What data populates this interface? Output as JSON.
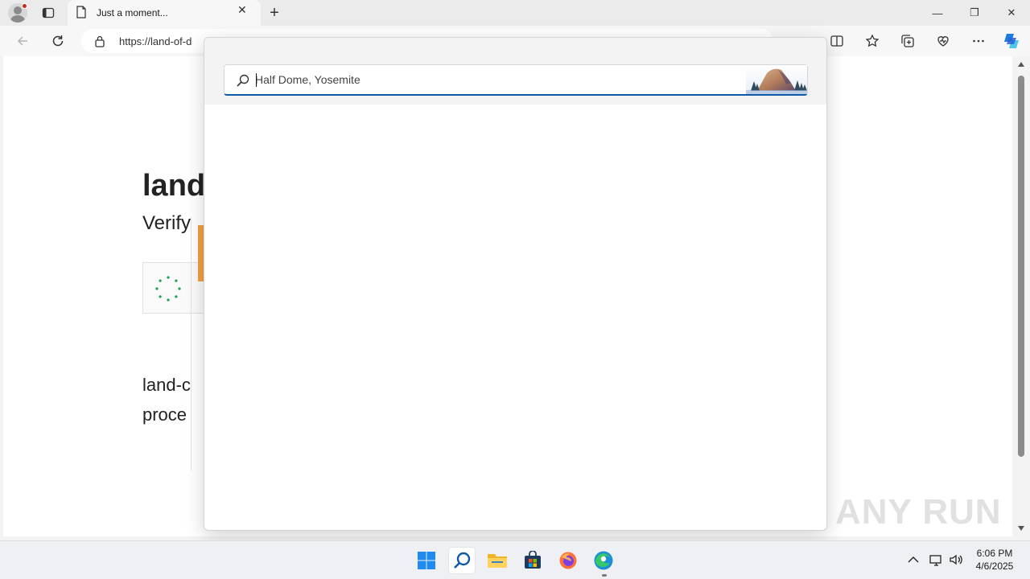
{
  "tab": {
    "title": "Just a moment...",
    "close_label": "✕"
  },
  "window_controls": {
    "minimize": "—",
    "restore": "❐",
    "close": "✕"
  },
  "address_bar": {
    "url": "https://land-of-d"
  },
  "page": {
    "heading": "land",
    "subheading": "Verify",
    "description_line1": "land-c",
    "description_line2": "proce"
  },
  "search": {
    "placeholder": "Half Dome, Yosemite",
    "highlight_image": "half-dome-mountain-illustration"
  },
  "watermark": "ANY RUN",
  "taskbar": {
    "apps": [
      "start",
      "search",
      "file-explorer",
      "microsoft-store",
      "firefox",
      "edge"
    ],
    "clock_time": "6:06 PM",
    "clock_date": "4/6/2025"
  },
  "colors": {
    "accent": "#0f5aa6",
    "captcha_spinner": "#1e9d55",
    "orange_accent": "#f2a040"
  }
}
